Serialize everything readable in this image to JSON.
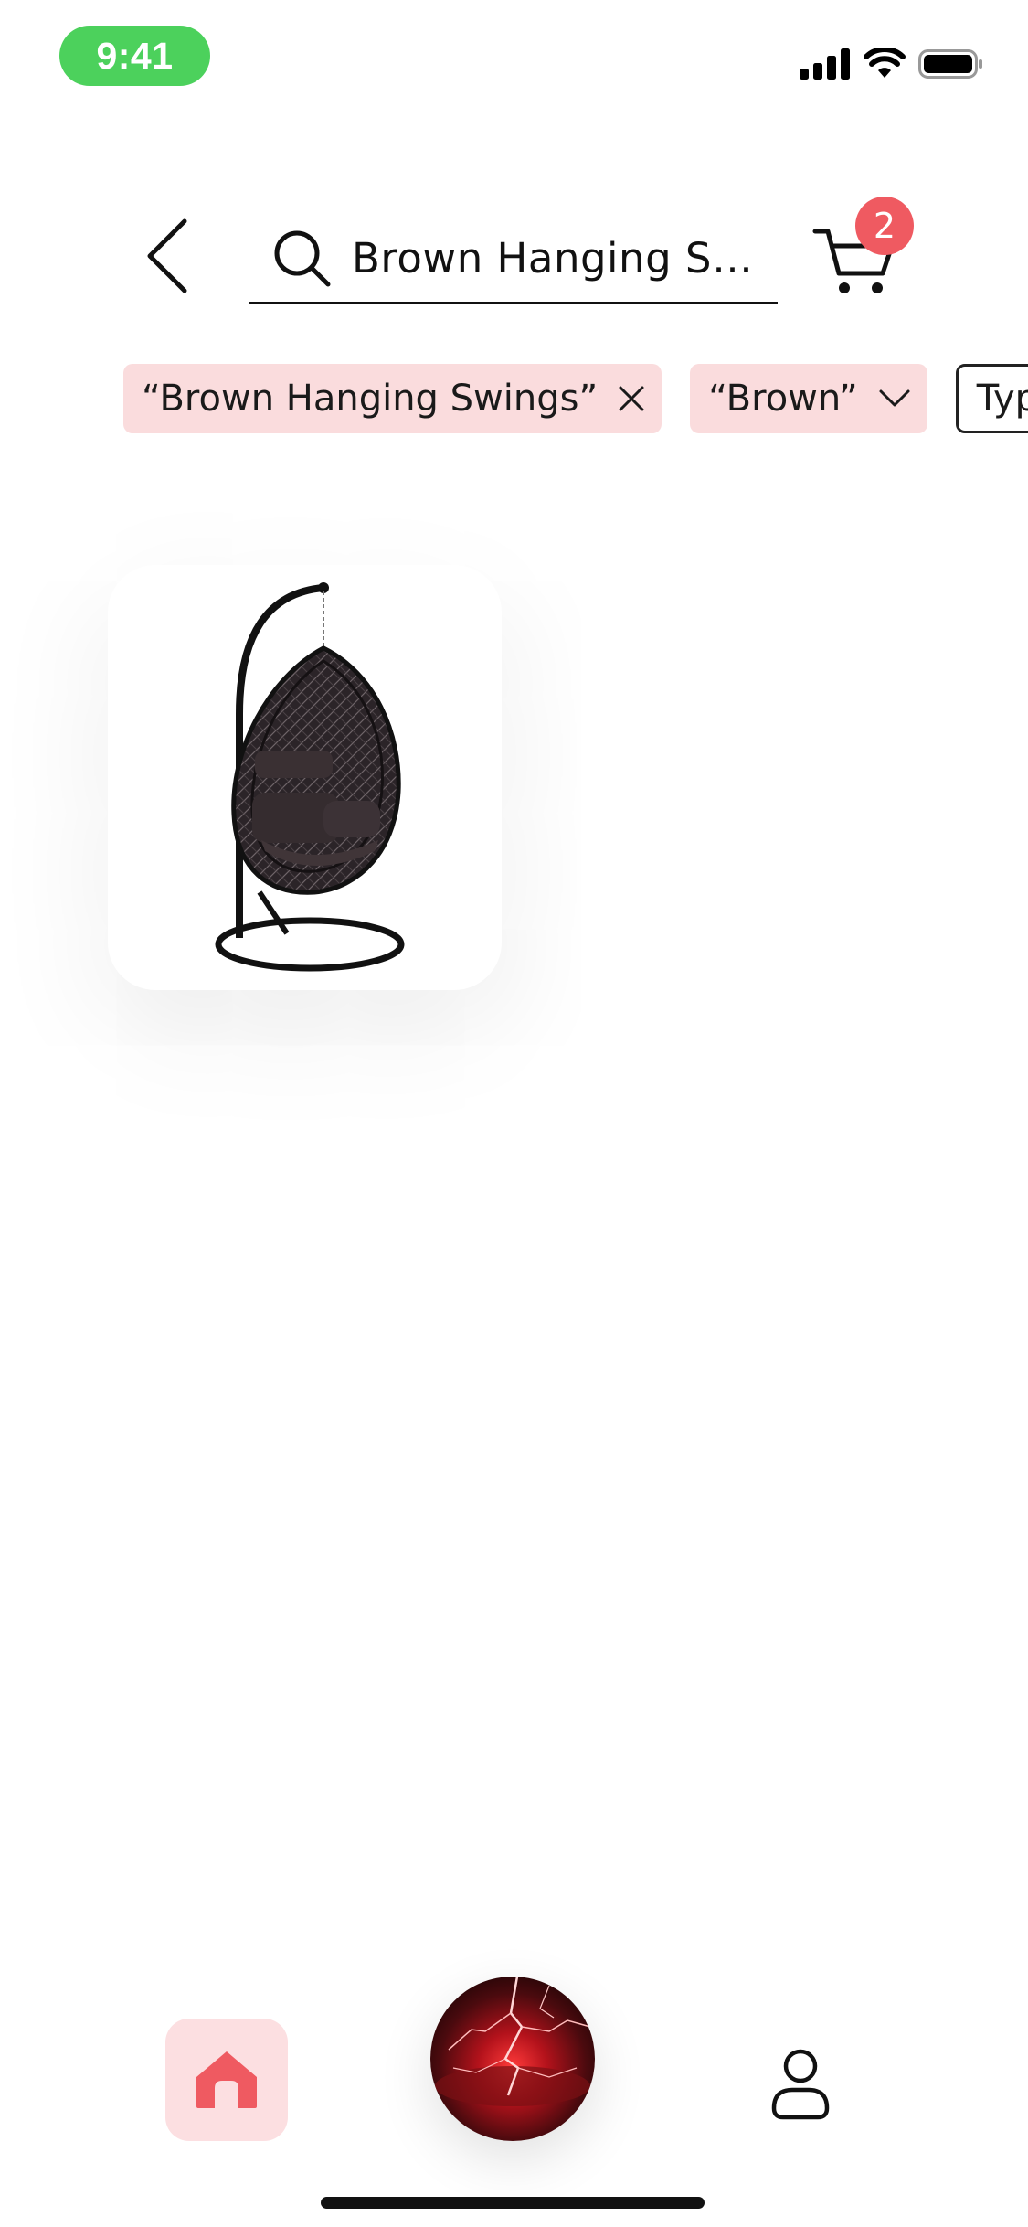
{
  "status_bar": {
    "time": "9:41"
  },
  "header": {
    "back_icon": "chevron-left-icon",
    "search": {
      "icon": "search-icon",
      "value": "Brown Hanging Sw..."
    },
    "cart": {
      "icon": "cart-icon",
      "badge_count": "2"
    }
  },
  "filters": {
    "chips": [
      {
        "label": "“Brown Hanging Swings”",
        "icon": "close-icon",
        "state": "active"
      },
      {
        "label": "“Brown”",
        "icon": "chevron-down-icon",
        "state": "active"
      },
      {
        "label": "Type",
        "icon": "chevron-down-icon",
        "state": "outline"
      }
    ]
  },
  "results": {
    "products": [
      {
        "image": "egg-hanging-swing-chair-image"
      }
    ]
  },
  "bottom_nav": {
    "home_icon": "home-icon",
    "center_icon": "lightning-orb-image",
    "profile_icon": "profile-icon"
  },
  "colors": {
    "accent": "#ef5a61",
    "chip_background": "#fadcdd",
    "time_pill": "#4cd15c",
    "text": "#111111"
  }
}
